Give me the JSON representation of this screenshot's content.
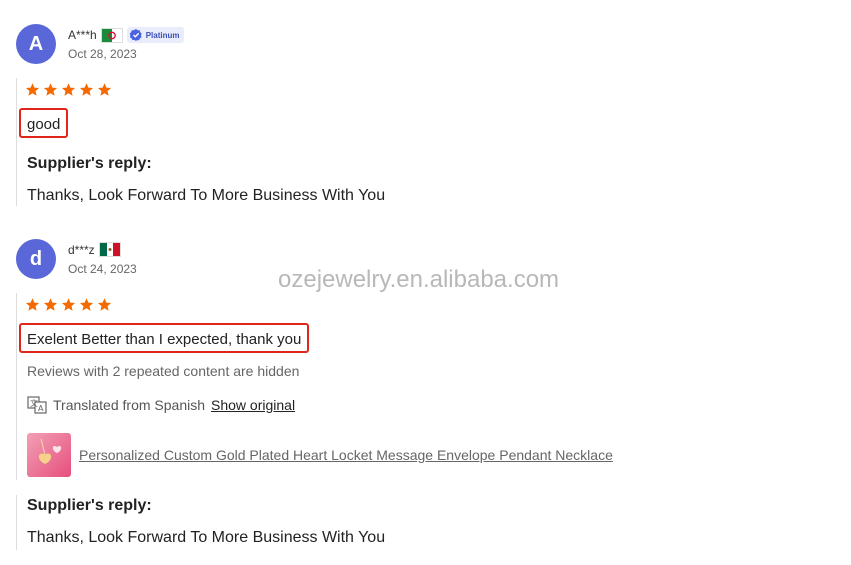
{
  "reviews": [
    {
      "avatar_letter": "A",
      "username": "A***h",
      "flag": "algeria-flag-icon",
      "badge": "Platinum",
      "date": "Oct 28, 2023",
      "rating": 5,
      "content": "good",
      "reply_title": "Supplier's reply:",
      "reply_text": "Thanks, Look Forward To More Business With You"
    },
    {
      "avatar_letter": "d",
      "username": "d***z",
      "flag": "mexico-flag-icon",
      "date": "Oct 24, 2023",
      "rating": 5,
      "content": "Exelent Better than I expected, thank you",
      "hidden_note": "Reviews with 2 repeated content are hidden",
      "translated_label": "Translated from Spanish",
      "show_original": "Show original",
      "product_title": "Personalized Custom Gold Plated Heart Locket Message Envelope Pendant Necklace",
      "reply_title": "Supplier's reply:",
      "reply_text": "Thanks, Look Forward To More Business With You"
    }
  ],
  "watermark": "ozejewelry.en.alibaba.com",
  "colors": {
    "star": "#f56a00",
    "highlight_border": "#e0261b",
    "avatar": "#5a67d8"
  }
}
